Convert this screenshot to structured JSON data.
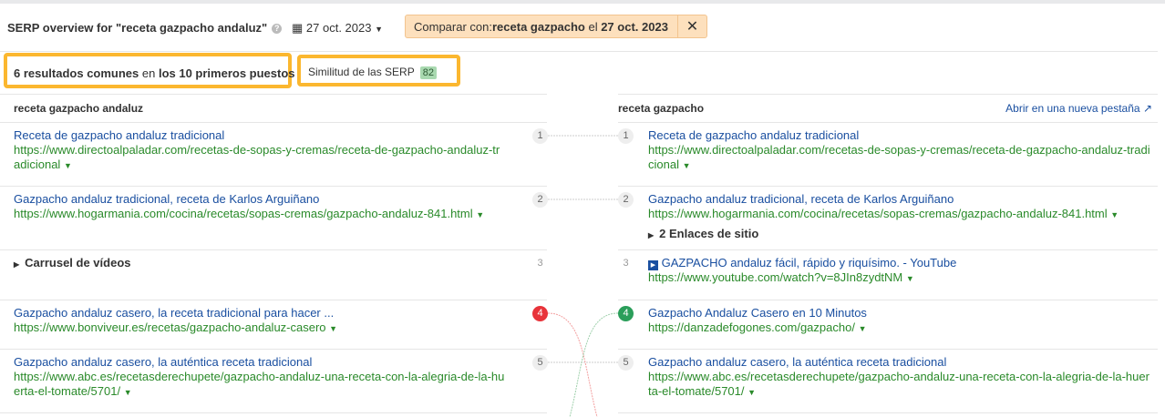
{
  "header": {
    "title": "SERP overview for \"receta gazpacho andaluz\"",
    "date": "27 oct. 2023",
    "compare_prefix": "Comparar con: ",
    "compare_keyword": "receta gazpacho",
    "compare_mid": " el ",
    "compare_date": "27 oct. 2023",
    "close": "✕"
  },
  "summary": {
    "count_text": "6 resultados comunes",
    "mid": " en ",
    "top_text": "los 10 primeros puestos",
    "similarity_label": "Similitud de las SERP",
    "similarity_value": "82"
  },
  "left": {
    "heading": "receta gazpacho andaluz",
    "results": [
      {
        "pos": "1",
        "title": "Receta de gazpacho andaluz tradicional",
        "url": "https://www.directoalpaladar.com/recetas-de-sopas-y-cremas/receta-de-gazpacho-andaluz-tradicional"
      },
      {
        "pos": "2",
        "title": "Gazpacho andaluz tradicional, receta de Karlos Arguiñano",
        "url": "https://www.hogarmania.com/cocina/recetas/sopas-cremas/gazpacho-andaluz-841.html"
      },
      {
        "pos": "3",
        "title": "Carrusel de vídeos"
      },
      {
        "pos": "4",
        "title": "Gazpacho andaluz casero, la receta tradicional para hacer ...",
        "url": "https://www.bonviveur.es/recetas/gazpacho-andaluz-casero"
      },
      {
        "pos": "5",
        "title": "Gazpacho andaluz casero, la auténtica receta tradicional",
        "url": "https://www.abc.es/recetasderechupete/gazpacho-andaluz-una-receta-con-la-alegria-de-la-huerta-el-tomate/5701/"
      }
    ]
  },
  "right": {
    "heading": "receta gazpacho",
    "open_new_tab": "Abrir en una nueva pestaña",
    "sitelinks": "2 Enlaces de sitio",
    "results": [
      {
        "pos": "1",
        "title": "Receta de gazpacho andaluz tradicional",
        "url": "https://www.directoalpaladar.com/recetas-de-sopas-y-cremas/receta-de-gazpacho-andaluz-tradicional"
      },
      {
        "pos": "2",
        "title": "Gazpacho andaluz tradicional, receta de Karlos Arguiñano",
        "url": "https://www.hogarmania.com/cocina/recetas/sopas-cremas/gazpacho-andaluz-841.html"
      },
      {
        "pos": "3",
        "title": "GAZPACHO andaluz fácil, rápido y riquísimo. - YouTube",
        "url": "https://www.youtube.com/watch?v=8JIn8zydtNM"
      },
      {
        "pos": "4",
        "title": "Gazpacho Andaluz Casero en 10 Minutos",
        "url": "https://danzadefogones.com/gazpacho/"
      },
      {
        "pos": "5",
        "title": "Gazpacho andaluz casero, la auténtica receta tradicional",
        "url": "https://www.abc.es/recetasderechupete/gazpacho-andaluz-una-receta-con-la-alegria-de-la-huerta-el-tomate/5701/"
      }
    ]
  }
}
